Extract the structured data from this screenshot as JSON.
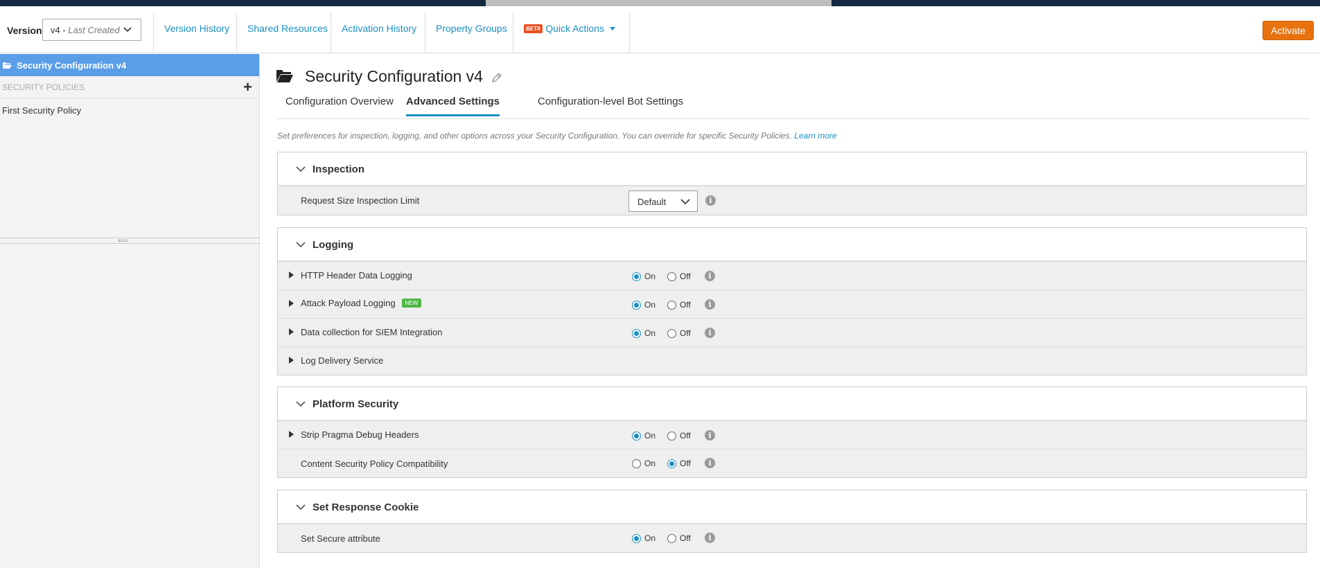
{
  "header": {
    "version_label": "Version",
    "version_value": "v4 - ",
    "version_sub": "Last Created",
    "nav": [
      "Version History",
      "Shared Resources",
      "Activation History",
      "Property Groups"
    ],
    "beta_badge": "BETA",
    "quick_actions": "Quick Actions",
    "activate": "Activate"
  },
  "sidebar": {
    "title": "Security Configuration v4",
    "section": "SECURITY POLICIES",
    "items": [
      "First Security Policy"
    ]
  },
  "main": {
    "title": "Security Configuration v4",
    "tabs": [
      "Configuration Overview",
      "Advanced Settings",
      "Configuration-level Bot Settings"
    ],
    "active_tab": "Advanced Settings",
    "description": "Set preferences for inspection, logging, and other options across your Security Configuration. You can override for specific Security Policies.",
    "learn_more": "Learn more"
  },
  "radio_labels": {
    "on": "On",
    "off": "Off"
  },
  "panels": {
    "inspection": {
      "title": "Inspection",
      "rows": [
        {
          "label": "Request Size Inspection Limit",
          "control": "dropdown",
          "value": "Default"
        }
      ]
    },
    "logging": {
      "title": "Logging",
      "rows": [
        {
          "label": "HTTP Header Data Logging",
          "expandable": true,
          "value": "On"
        },
        {
          "label": "Attack Payload Logging",
          "badge": "NEW",
          "expandable": true,
          "value": "On"
        },
        {
          "label": "Data collection for SIEM Integration",
          "expandable": true,
          "value": "On"
        },
        {
          "label": "Log Delivery Service",
          "expandable": true
        }
      ]
    },
    "platform": {
      "title": "Platform Security",
      "rows": [
        {
          "label": "Strip Pragma Debug Headers",
          "expandable": true,
          "value": "On"
        },
        {
          "label": "Content Security Policy Compatibility",
          "expandable": false,
          "value": "Off"
        }
      ]
    },
    "cookie": {
      "title": "Set Response Cookie",
      "rows": [
        {
          "label": "Set Secure attribute",
          "expandable": false,
          "value": "On"
        }
      ]
    }
  },
  "colors": {
    "accent": "#1a8fc4",
    "activate": "#e8730e",
    "sidebar_active": "#5b9ee8",
    "new_badge": "#4db847"
  }
}
